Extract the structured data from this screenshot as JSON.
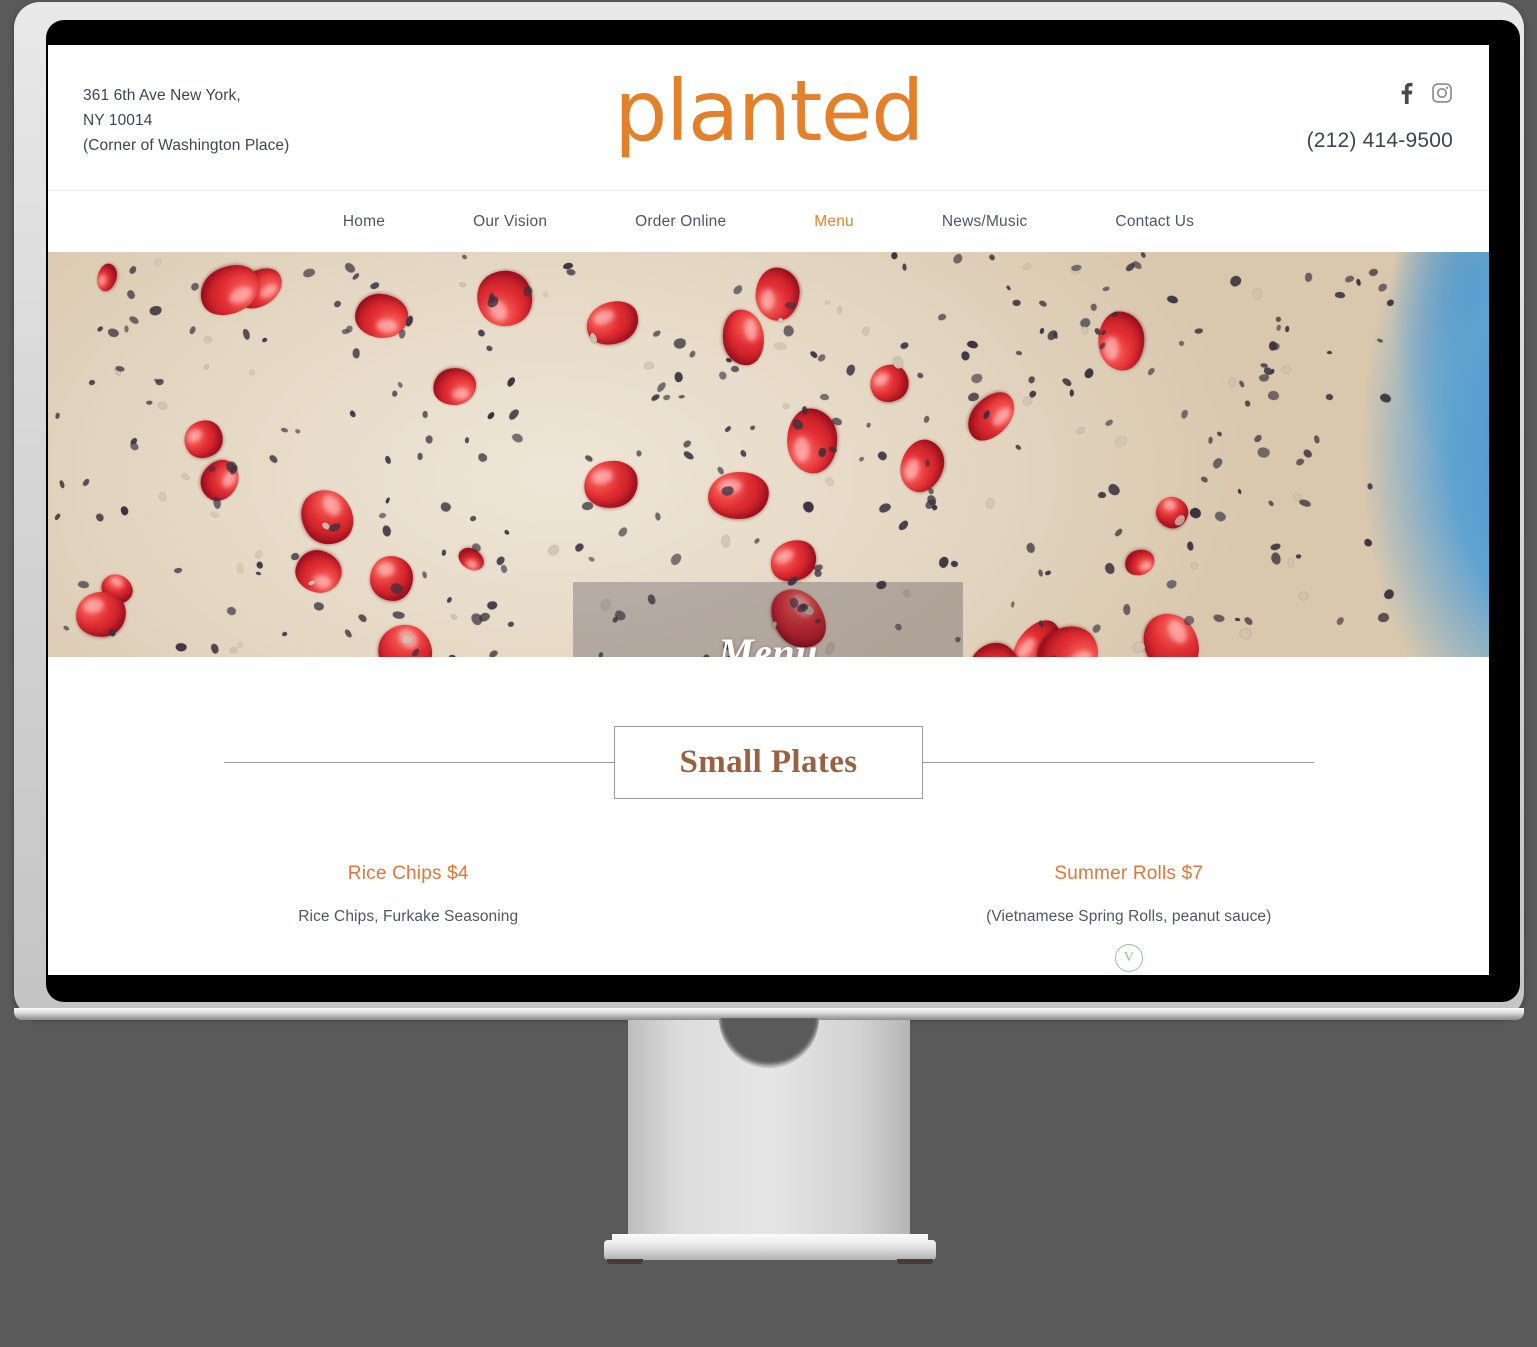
{
  "site": {
    "logo_text": "planted",
    "brand_orange": "#e2802b",
    "address_line1": "361 6th Ave New York,",
    "address_line2": "NY 10014",
    "address_line3": "(Corner of Washington Place)",
    "phone": "(212) 414-9500",
    "socials": [
      {
        "name": "facebook-icon",
        "glyph": "f"
      },
      {
        "name": "instagram-icon",
        "glyph": "instagram"
      }
    ]
  },
  "nav": {
    "active": "Menu",
    "items": [
      {
        "label": "Home",
        "active": false
      },
      {
        "label": "Our Vision",
        "active": false
      },
      {
        "label": "Order Online",
        "active": false
      },
      {
        "label": "Menu",
        "active": true
      },
      {
        "label": "News/Music",
        "active": false
      },
      {
        "label": "Contact Us",
        "active": false
      }
    ]
  },
  "hero": {
    "title": "Menu",
    "image_description": "close-up of creamy oatmeal bowl topped with pomegranate seeds and chia seeds in a blue bowl",
    "overlay_color": "rgba(35,28,45,0.26)"
  },
  "menu": {
    "section_title": "Small Plates",
    "section_title_color": "#9a6140",
    "items": [
      {
        "name": "Rice Chips $4",
        "description": "Rice Chips, Furkake Seasoning",
        "badge": null
      },
      {
        "name": "Summer Rolls $7",
        "description": "(Vietnamese Spring Rolls, peanut sauce)",
        "badge": "V"
      }
    ],
    "item_color": "#e2763a",
    "badge_color": "#8dc98d"
  }
}
